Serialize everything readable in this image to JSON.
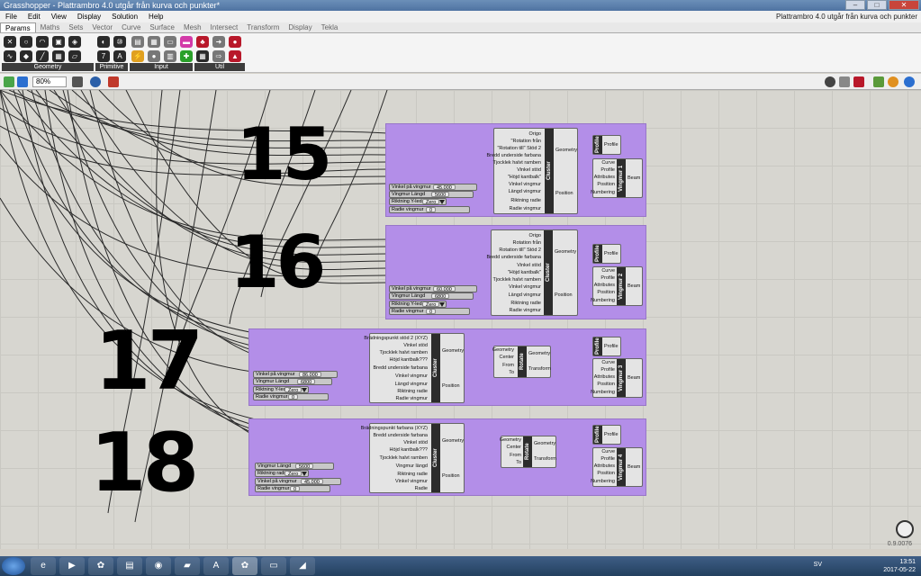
{
  "window": {
    "title": "Grasshopper - Plattrambro 4.0 utgår från kurva och punkter*",
    "doc_title": "Plattrambro 4.0 utgår från kurva och punkter",
    "buttons": [
      "–",
      "□",
      "✕"
    ]
  },
  "menu": [
    "File",
    "Edit",
    "View",
    "Display",
    "Solution",
    "Help"
  ],
  "tabs": [
    {
      "label": "Params",
      "active": true
    },
    {
      "label": "Maths"
    },
    {
      "label": "Sets"
    },
    {
      "label": "Vector"
    },
    {
      "label": "Curve"
    },
    {
      "label": "Surface"
    },
    {
      "label": "Mesh"
    },
    {
      "label": "Intersect"
    },
    {
      "label": "Transform"
    },
    {
      "label": "Display"
    },
    {
      "label": "Tekla"
    }
  ],
  "ribbon_groups": [
    "Geometry",
    "Primitive",
    "Input",
    "Util"
  ],
  "canvas_toolbar": {
    "zoom": "80%"
  },
  "hand_numbers": [
    "15",
    "16",
    "17",
    "18"
  ],
  "clusters": [
    {
      "inputs": [
        "Origo",
        "\"Rotation från",
        "\"Rotation till\" Stöd 2",
        "Bredd underside farbana",
        "Tjocklek halvt ramben",
        "Vinkel stöd",
        "\"Höjd kantbalk\"",
        "Vinkel vingmur",
        "Längd vingmur",
        "Riktning radie",
        "Radie vingmur"
      ],
      "outputs": [
        "Geometry",
        "Position"
      ],
      "label": "Cluster",
      "sliders": [
        {
          "label": "Vinkel på vingmur",
          "value": "45.000"
        },
        {
          "label": "Vingmur Längd",
          "value": "5600"
        },
        {
          "label": "Riktning Y-led",
          "value": "Zero",
          "dropdown": true
        },
        {
          "label": "Radie vingmur",
          "value": "0"
        }
      ],
      "profile": {
        "label": "Profile",
        "out": "Profile"
      },
      "vingmur": {
        "label": "Vingmur 1",
        "inputs": [
          "Curve",
          "Profile",
          "Attributes",
          "Position",
          "Numbering"
        ],
        "output": "Beam"
      }
    },
    {
      "inputs": [
        "Origo",
        "Rotation från",
        "Rotation till\" Stöd 2",
        "Bredd underside farbana",
        "Vinkel stöd",
        "\"Höjd kantbalk\"",
        "Tjocklek halvt ramben",
        "Vinkel vingmur",
        "Längd vingmur",
        "Riktning radie",
        "Radie vingmur"
      ],
      "outputs": [
        "Geometry",
        "Position"
      ],
      "label": "Cluster",
      "sliders": [
        {
          "label": "Vinkel på vingmur",
          "value": "60.000"
        },
        {
          "label": "Vingmur Längd",
          "value": "6800"
        },
        {
          "label": "Riktning Y-led",
          "value": "Zero",
          "dropdown": true
        },
        {
          "label": "Radie vingmur",
          "value": "0"
        }
      ],
      "profile": {
        "label": "Profile",
        "out": "Profile"
      },
      "vingmur": {
        "label": "Vingmur 2",
        "inputs": [
          "Curve",
          "Profile",
          "Attributes",
          "Position",
          "Numbering"
        ],
        "output": "Beam"
      }
    },
    {
      "inputs": [
        "Brädningspunkt stöd 2 (XYZ)",
        "Vinkel stöd",
        "Tjocklek halvt ramben",
        "Höjd kantbalk???",
        "Bredd underside farbana",
        "Vinkel vingmur",
        "Längd vingmur",
        "Riktning radie",
        "Radie vingmur"
      ],
      "outputs": [
        "Geometry",
        "Position"
      ],
      "label": "Cluster",
      "sliders": [
        {
          "label": "Vinkel på vingmur",
          "value": "86.000"
        },
        {
          "label": "Vingmur Längd",
          "value": "6800"
        },
        {
          "label": "Riktning Y-led",
          "value": "Zero",
          "dropdown": true
        },
        {
          "label": "Radie vingmur",
          "value": "0"
        }
      ],
      "rotate": {
        "label": "Rotate",
        "inputs": [
          "Geometry",
          "Center",
          "From",
          "To"
        ],
        "outputs": [
          "Geometry",
          "Transform"
        ]
      },
      "profile": {
        "label": "Profile",
        "out": "Profile"
      },
      "vingmur": {
        "label": "Vingmur 3",
        "inputs": [
          "Curve",
          "Profile",
          "Attributes",
          "Position",
          "Numbering"
        ],
        "output": "Beam"
      }
    },
    {
      "inputs": [
        "Brädningspunkt farbana (XYZ)",
        "Bredd underside farbana",
        "Vinkel stöd",
        "Höjd kantbalk???",
        "Tjocklek halvt ramben",
        "Vingmur längd",
        "Riktning radie",
        "Vinkel vingmur",
        "Radie"
      ],
      "outputs": [
        "Geometry",
        "Position"
      ],
      "label": "Cluster",
      "sliders": [
        {
          "label": "Vingmur Längd",
          "value": "5600"
        },
        {
          "label": "Riktning radie",
          "value": "Zero",
          "dropdown": true
        },
        {
          "label": "Vinkel på vingmur",
          "value": "45.000"
        },
        {
          "label": "Radie vingmur",
          "value": "0"
        }
      ],
      "rotate": {
        "label": "Rotate",
        "inputs": [
          "Geometry",
          "Center",
          "From",
          "To"
        ],
        "outputs": [
          "Geometry",
          "Transform"
        ]
      },
      "profile": {
        "label": "Profile",
        "out": "Profile"
      },
      "vingmur": {
        "label": "Vingmur 4",
        "inputs": [
          "Curve",
          "Profile",
          "Attributes",
          "Position",
          "Numbering"
        ],
        "output": "Beam"
      }
    }
  ],
  "status": {
    "version": "0.9.0076"
  },
  "taskbar": {
    "lang": "SV",
    "time": "13:51",
    "date": "2017-05-22"
  }
}
